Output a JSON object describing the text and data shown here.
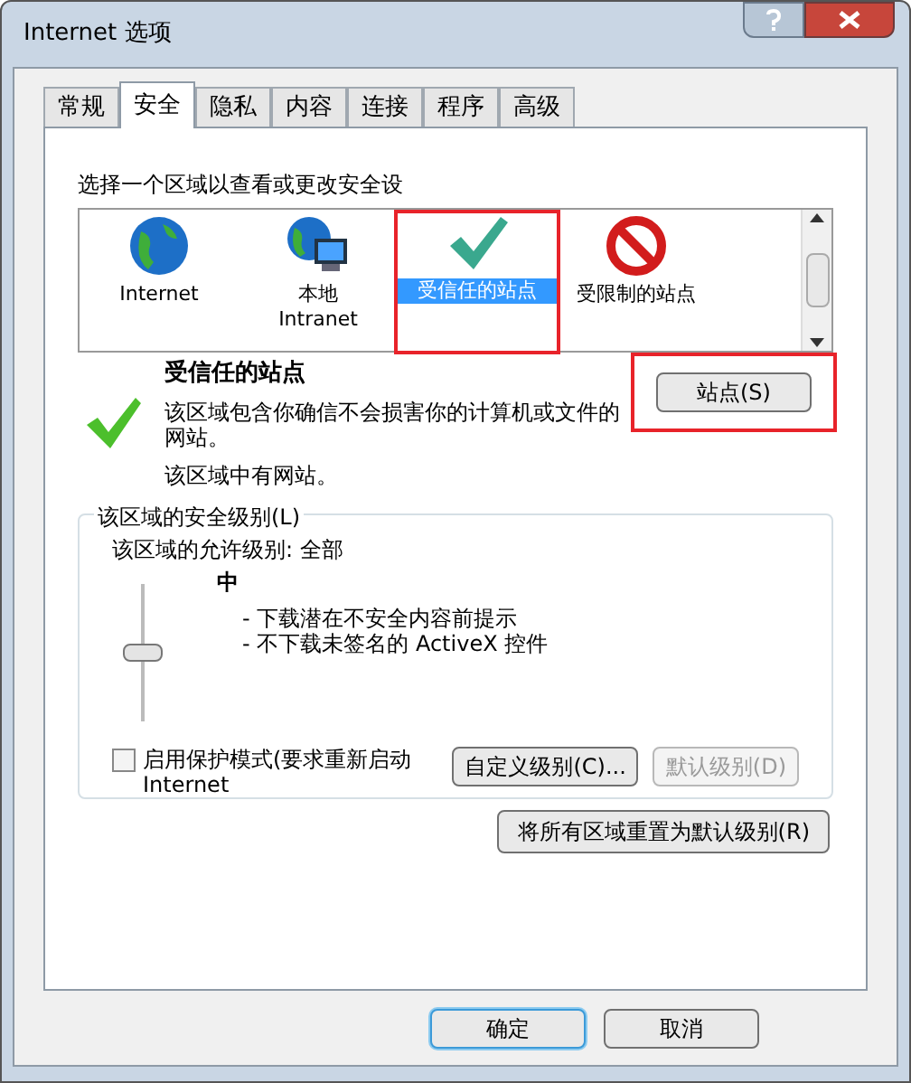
{
  "window": {
    "title": "Internet 选项"
  },
  "tabs": [
    {
      "label": "常规",
      "selected": false
    },
    {
      "label": "安全",
      "selected": true
    },
    {
      "label": "隐私",
      "selected": false
    },
    {
      "label": "内容",
      "selected": false
    },
    {
      "label": "连接",
      "selected": false
    },
    {
      "label": "程序",
      "selected": false
    },
    {
      "label": "高级",
      "selected": false
    }
  ],
  "zone_prompt": "选择一个区域以查看或更改安全设",
  "zones": [
    {
      "kind": "globe",
      "label": "Internet",
      "selected": false,
      "highlighted": false
    },
    {
      "kind": "intranet",
      "label": "本地\nIntranet",
      "selected": false,
      "highlighted": false
    },
    {
      "kind": "check",
      "label": "受信任的站点",
      "selected": true,
      "highlighted": true
    },
    {
      "kind": "forbidden",
      "label": "受限制的站点",
      "selected": false,
      "highlighted": false
    }
  ],
  "zone_info": {
    "title": "受信任的站点",
    "description": "该区域包含你确信不会损害你的计算机或文件的网站。",
    "status": "该区域中有网站。"
  },
  "sites_button": {
    "label": "站点(S)",
    "highlighted": true
  },
  "security_level": {
    "legend": "该区域的安全级别(L)",
    "allowed": "该区域的允许级别: 全部",
    "level": 0.5,
    "level_name": "中",
    "bullets": [
      "- 下载潜在不安全内容前提示",
      "- 不下载未签名的 ActiveX 控件"
    ]
  },
  "protected_mode": {
    "label": "启用保护模式(要求重新启动 Internet",
    "checked": false
  },
  "level_buttons": [
    {
      "label": "自定义级别(C)...",
      "disabled": false
    },
    {
      "label": "默认级别(D)",
      "disabled": true
    }
  ],
  "reset_button": "将所有区域重置为默认级别(R)",
  "dialog_buttons": [
    {
      "label": "确定",
      "default": true
    },
    {
      "label": "取消",
      "default": false
    }
  ]
}
